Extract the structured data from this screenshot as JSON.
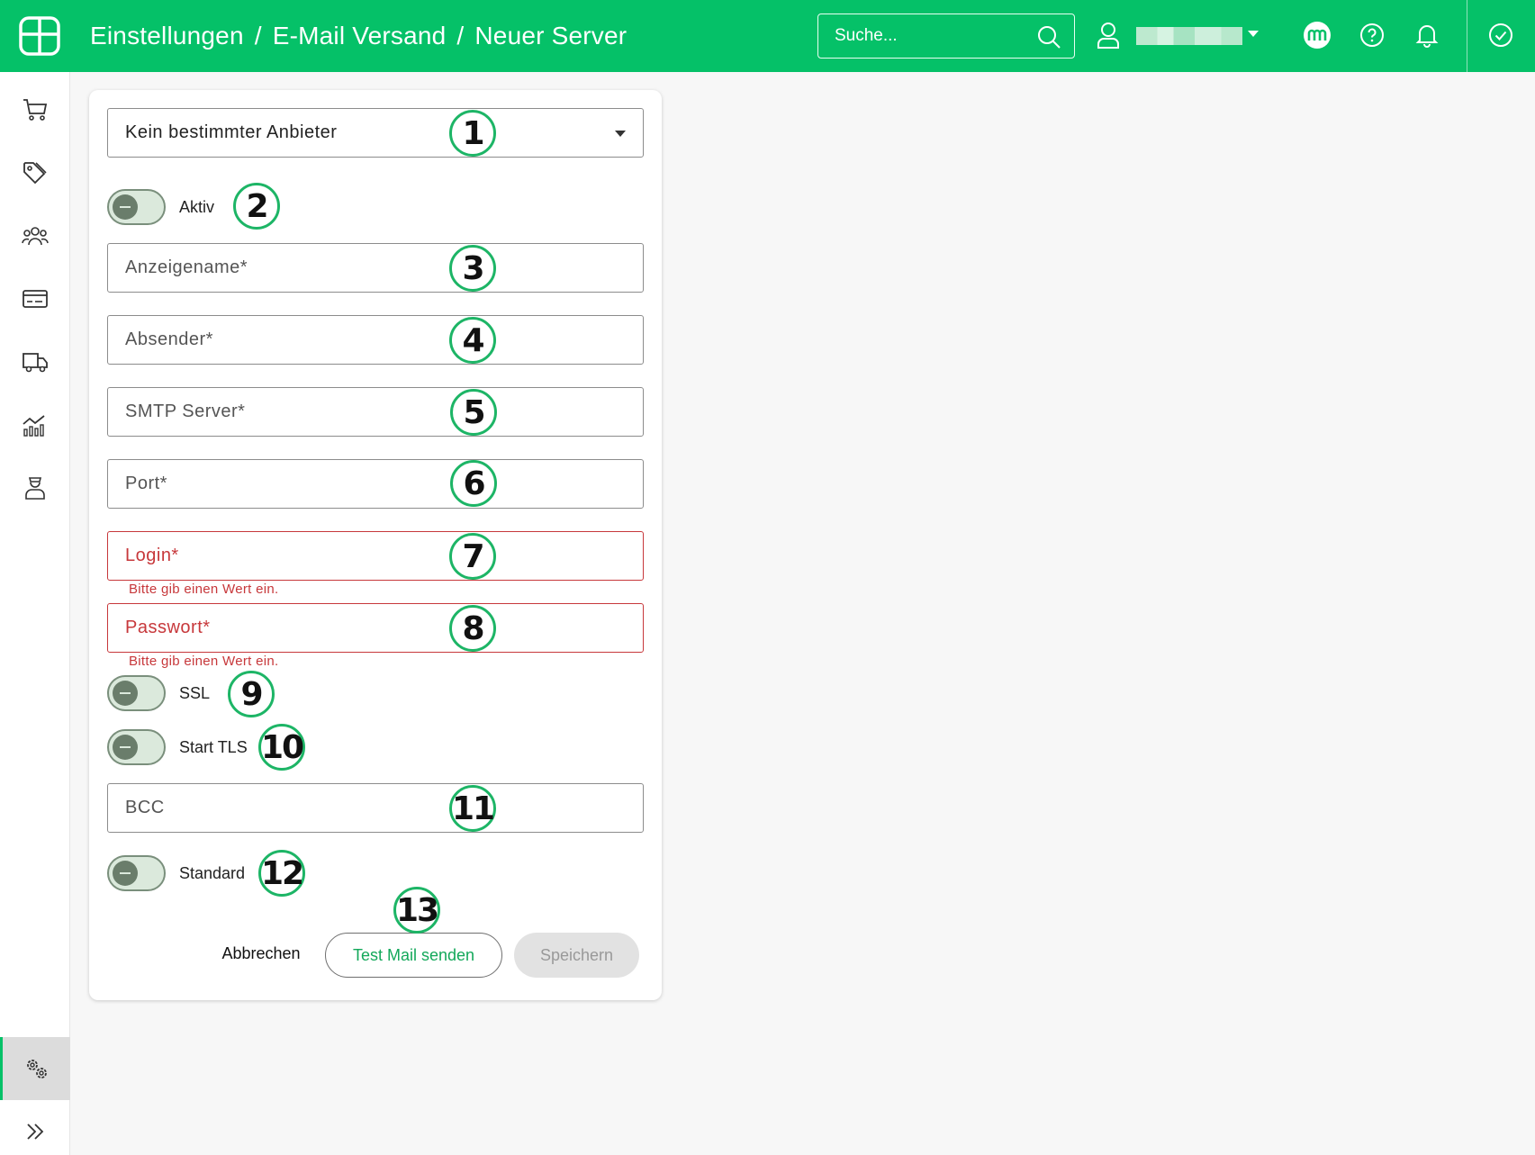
{
  "header": {
    "breadcrumb": [
      "Einstellungen",
      "E-Mail Versand",
      "Neuer Server"
    ],
    "separator": "/",
    "search_placeholder": "Suche..."
  },
  "sidebar": {
    "items": [
      {
        "icon": "cart-icon"
      },
      {
        "icon": "tags-icon"
      },
      {
        "icon": "users-icon"
      },
      {
        "icon": "card-icon"
      },
      {
        "icon": "truck-icon"
      },
      {
        "icon": "chart-icon"
      },
      {
        "icon": "employee-icon"
      }
    ],
    "settings_icon": "gears-icon",
    "expand_icon": "chevrons-right-icon"
  },
  "form": {
    "provider": "Kein bestimmter Anbieter",
    "active_label": "Aktiv",
    "display_name": "Anzeigename*",
    "sender": "Absender*",
    "smtp_server": "SMTP Server*",
    "port": "Port*",
    "login": "Login*",
    "login_error": "Bitte gib einen Wert ein.",
    "password": "Passwort*",
    "password_error": "Bitte gib einen Wert ein.",
    "ssl_label": "SSL",
    "starttls_label": "Start TLS",
    "bcc": "BCC",
    "standard_label": "Standard",
    "cancel_label": "Abbrechen",
    "test_label": "Test Mail senden",
    "save_label": "Speichern"
  },
  "badges": [
    "1",
    "2",
    "3",
    "4",
    "5",
    "6",
    "7",
    "8",
    "9",
    "10",
    "11",
    "12",
    "13"
  ],
  "colors": {
    "brand": "#05c168",
    "error": "#c7383b",
    "badge_border": "#1db566"
  }
}
